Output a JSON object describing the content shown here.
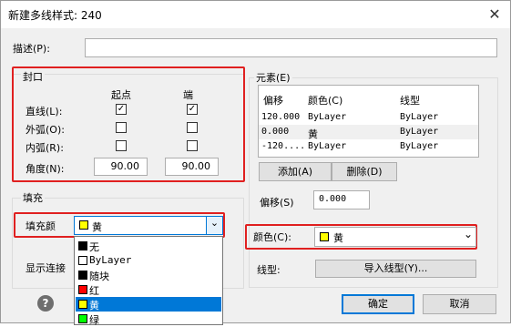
{
  "window": {
    "title": "新建多线样式: 240",
    "close_glyph": "✕"
  },
  "description": {
    "label": "描述(P):",
    "value": ""
  },
  "caps": {
    "title": "封口",
    "col_start": "起点",
    "col_end": "端",
    "rows": [
      {
        "label": "直线(L):",
        "start": true,
        "end": true
      },
      {
        "label": "外弧(O):",
        "start": false,
        "end": false
      },
      {
        "label": "内弧(R):",
        "start": false,
        "end": false
      }
    ],
    "angle": {
      "label": "角度(N):",
      "start": "90.00",
      "end": "90.00"
    }
  },
  "fill": {
    "title": "填充",
    "label": "填充颜",
    "selected": {
      "name": "黄",
      "color": "#ffff00"
    },
    "arrow": "⌄",
    "options": [
      {
        "name": "无",
        "color": "#000000"
      },
      {
        "name": "ByLayer",
        "color": "#ffffff"
      },
      {
        "name": "随块",
        "color": "#000000"
      },
      {
        "name": "红",
        "color": "#ff0000"
      },
      {
        "name": "黄",
        "color": "#ffff00",
        "selected": true
      },
      {
        "name": "绿",
        "color": "#00ff00"
      }
    ]
  },
  "display_joints": {
    "label": "显示连接"
  },
  "elements": {
    "title": "元素(E)",
    "headers": [
      "偏移",
      "颜色(C)",
      "线型"
    ],
    "rows": [
      {
        "offset": "120.000",
        "color": "ByLayer",
        "linetype": "ByLayer",
        "selected": false
      },
      {
        "offset": "0.000",
        "color": "黄",
        "linetype": "ByLayer",
        "selected": true
      },
      {
        "offset": "-120....",
        "color": "ByLayer",
        "linetype": "ByLayer",
        "selected": false
      }
    ],
    "add_button": "添加(A)",
    "delete_button": "删除(D)",
    "offset": {
      "label": "偏移(S)",
      "value": "0.000"
    },
    "color": {
      "label": "颜色(C):",
      "value": "黄",
      "swatch": "#ffff00",
      "arrow": "⌄"
    },
    "linetype": {
      "label": "线型:",
      "button": "导入线型(Y)..."
    }
  },
  "footer": {
    "ok": "确定",
    "cancel": "取消",
    "help": "?"
  },
  "colors": {
    "accent": "#0078d7",
    "highlight": "#e02020"
  }
}
